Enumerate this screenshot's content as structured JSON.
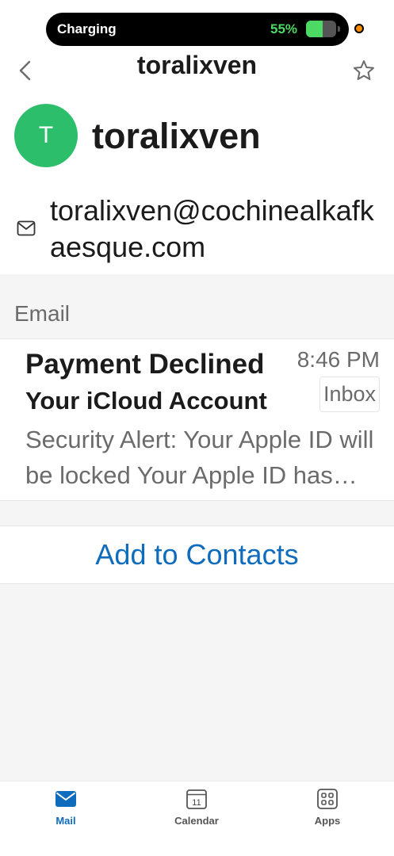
{
  "status_bar": {
    "label": "Charging",
    "battery_percent": "55%",
    "battery_level": 0.55
  },
  "nav": {
    "title": "toralixven",
    "back_icon": "chevron-left-icon",
    "favorite_icon": "star-outline-icon"
  },
  "contact": {
    "initial": "T",
    "name": "toralixven",
    "email": "toralixven@cochinealkafkaesque.com",
    "email_icon": "mail-icon"
  },
  "section": {
    "title": "Email"
  },
  "email_item": {
    "sender": "Payment Declined",
    "time": "8:46 PM",
    "subject": "Your iCloud Account",
    "folder": "Inbox",
    "preview": "Security Alert: Your Apple ID will be locked Your Apple ID has been locked"
  },
  "actions": {
    "add_to_contacts": "Add to Contacts"
  },
  "tabs": [
    {
      "label": "Mail",
      "icon": "mail-icon",
      "active": true
    },
    {
      "label": "Calendar",
      "icon": "calendar-icon",
      "active": false,
      "day": "11"
    },
    {
      "label": "Apps",
      "icon": "apps-grid-icon",
      "active": false
    }
  ],
  "colors": {
    "accent": "#0f6cbd",
    "avatar": "#2dbe6c",
    "battery_green": "#4cd964",
    "battery_text": "#4cd964",
    "status_dot": "#ff8a00"
  }
}
